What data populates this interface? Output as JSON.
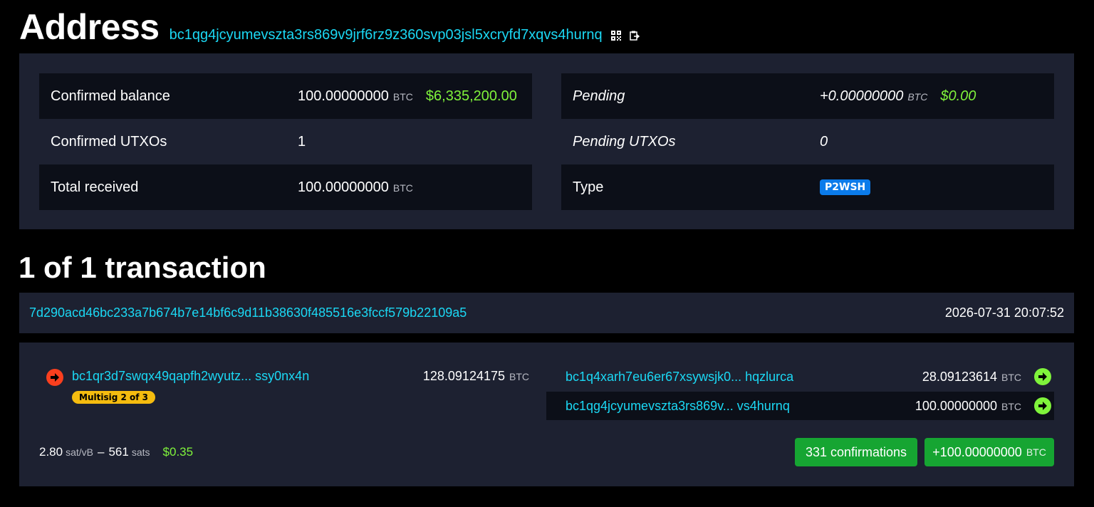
{
  "header": {
    "title": "Address",
    "address": "bc1qg4jcyumevszta3rs869v9jrf6rz9z360svp03jsl5xcryfd7xqvs4hurnq",
    "icons": [
      "qr-code-icon",
      "clipboard-icon"
    ]
  },
  "summary": {
    "left": [
      {
        "label": "Confirmed balance",
        "value": "100.00000000",
        "unit": "BTC",
        "usd": "$6,335,200.00"
      },
      {
        "label": "Confirmed UTXOs",
        "value": "1"
      },
      {
        "label": "Total received",
        "value": "100.00000000",
        "unit": "BTC"
      }
    ],
    "right": [
      {
        "label": "Pending",
        "value": "+0.00000000",
        "unit": "BTC",
        "usd": "$0.00"
      },
      {
        "label": "Pending UTXOs",
        "value": "0"
      },
      {
        "label": "Type",
        "badge": "P2WSH"
      }
    ]
  },
  "transactions": {
    "heading": "1 of 1 transaction",
    "items": [
      {
        "txid": "7d290acd46bc233a7b674b7e14bf6c9d11b38630f485516e3fccf579b22109a5",
        "timestamp": "2026-07-31 20:07:52",
        "input": {
          "address": "bc1qr3d7swqx49qapfh2wyutz... ssy0nx4n",
          "amount": "128.09124175",
          "unit": "BTC",
          "tag": "Multisig 2 of 3"
        },
        "outputs": [
          {
            "address": "bc1q4xarh7eu6er67xsywsjk0... hqzlurca",
            "amount": "28.09123614",
            "unit": "BTC"
          },
          {
            "address": "bc1qg4jcyumevszta3rs869v... vs4hurnq",
            "amount": "100.00000000",
            "unit": "BTC"
          }
        ],
        "fee": {
          "rate": "2.80",
          "rate_unit": "sat/vB",
          "separator": "–",
          "sats": "561",
          "sats_unit": "sats",
          "usd": "$0.35"
        },
        "confirmations_label": "331 confirmations",
        "net_amount": "+100.00000000",
        "net_unit": "BTC"
      }
    ]
  },
  "colors": {
    "link": "#1bd8f4",
    "usd": "#7ff33b",
    "panel": "#1d2131",
    "row_dark": "#0c0f18",
    "success": "#16a532",
    "badge_blue": "#0b7bea",
    "badge_yellow": "#f5bc0f",
    "input_arrow": "#fa3f1e",
    "output_arrow": "#7ff33b"
  }
}
